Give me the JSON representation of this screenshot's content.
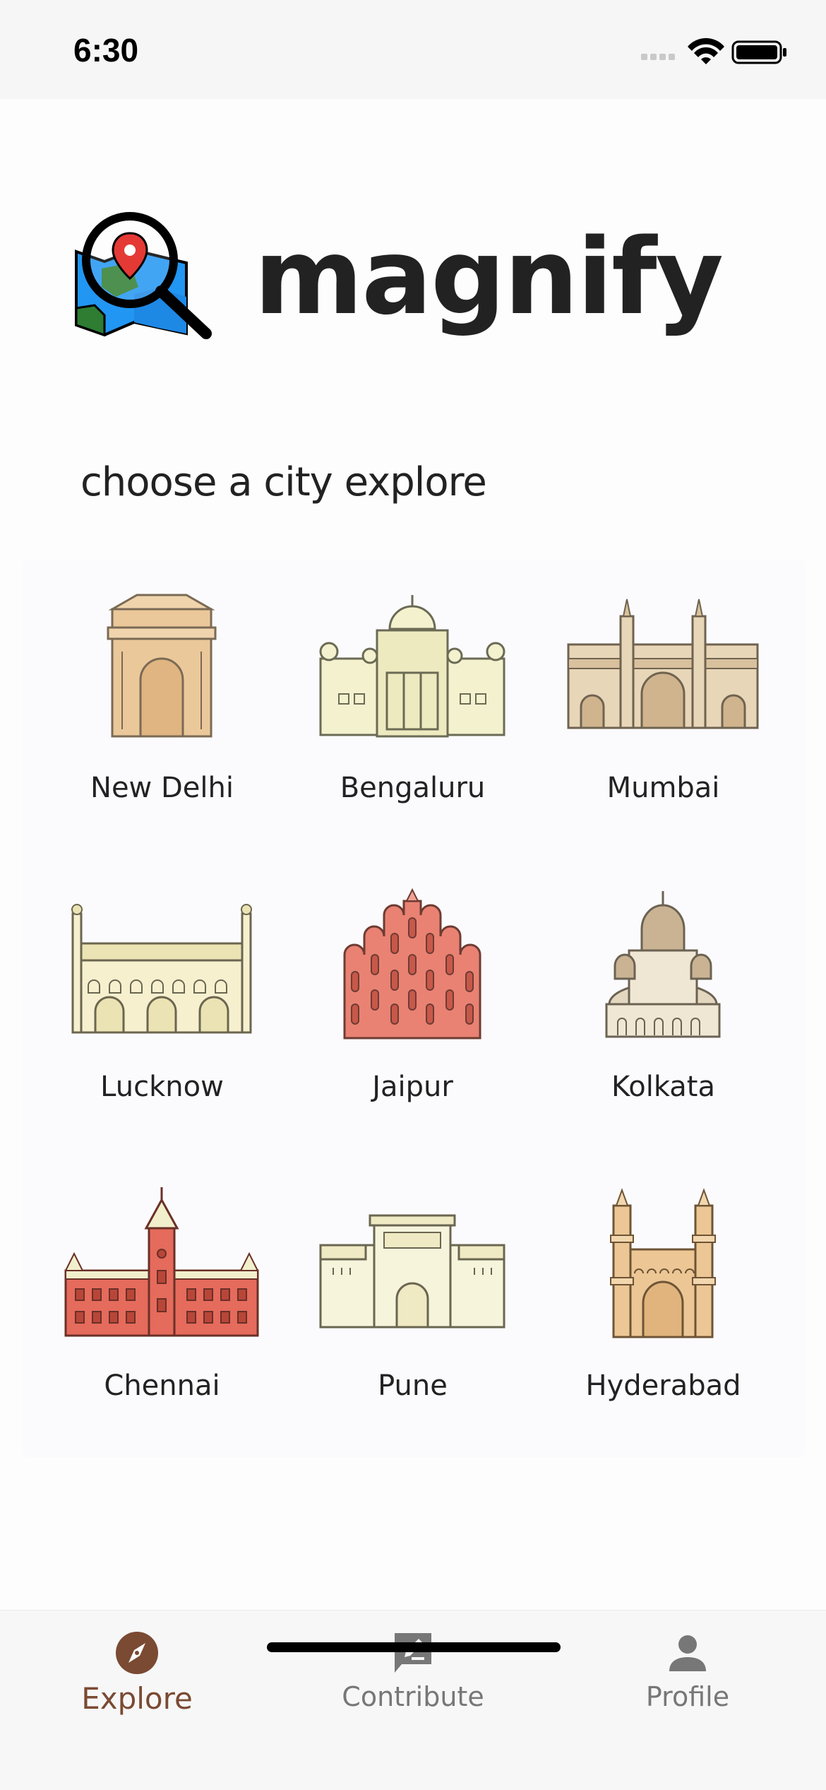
{
  "status_bar": {
    "time": "6:30"
  },
  "app": {
    "title": "magnify",
    "subtitle": "choose a city explore"
  },
  "cities": [
    {
      "name": "New Delhi",
      "icon": "india-gate-icon"
    },
    {
      "name": "Bengaluru",
      "icon": "vidhana-soudha-icon"
    },
    {
      "name": "Mumbai",
      "icon": "gateway-of-india-icon"
    },
    {
      "name": "Lucknow",
      "icon": "bara-imambara-icon"
    },
    {
      "name": "Jaipur",
      "icon": "hawa-mahal-icon"
    },
    {
      "name": "Kolkata",
      "icon": "victoria-memorial-icon"
    },
    {
      "name": "Chennai",
      "icon": "chennai-central-icon"
    },
    {
      "name": "Pune",
      "icon": "shaniwar-wada-icon"
    },
    {
      "name": "Hyderabad",
      "icon": "charminar-icon"
    }
  ],
  "nav": {
    "explore": "Explore",
    "contribute": "Contribute",
    "profile": "Profile",
    "active": "explore"
  },
  "colors": {
    "accent": "#7b4a32",
    "inactive": "#777777",
    "title": "#222222"
  }
}
